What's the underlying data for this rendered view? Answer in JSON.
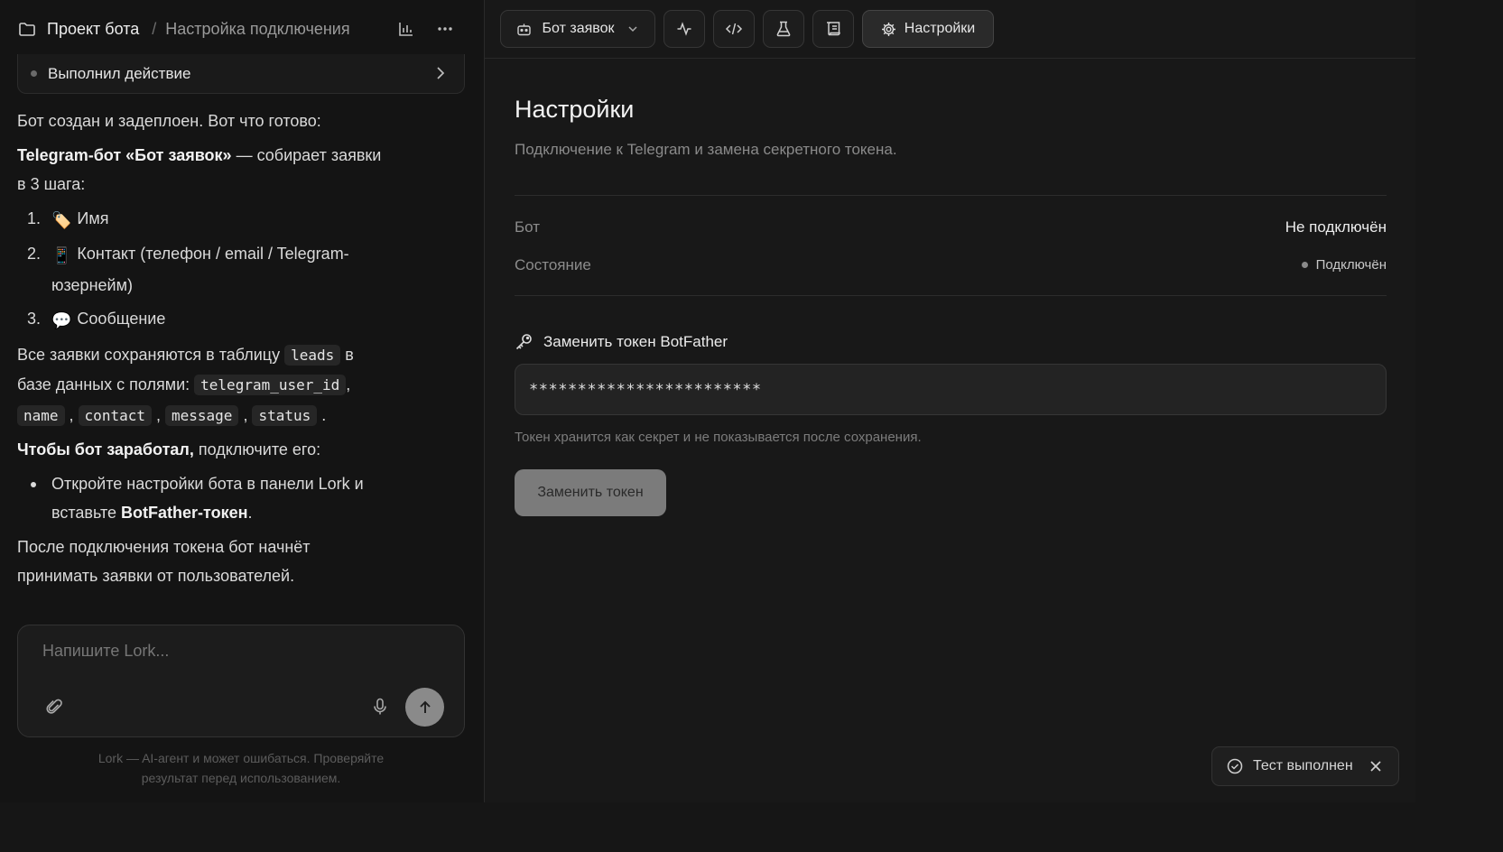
{
  "left": {
    "breadcrumb": {
      "project": "Проект бота",
      "separator": "/",
      "page": "Настройка подключения"
    },
    "action_card": {
      "label": "Выполнил действие"
    },
    "message": {
      "intro": "Бот создан и задеплоен. Вот что готово:",
      "bot_title": "Telegram-бот «Бот заявок»",
      "bot_desc_1": " — собирает заявки",
      "bot_desc_2": "в 3 шага:",
      "steps": [
        {
          "num": "1.",
          "emoji": "🏷️",
          "text": "Имя"
        },
        {
          "num": "2.",
          "emoji": "📱",
          "text_1": "Контакт (телефон / email / Telegram-",
          "text_2": "юзернейм)"
        },
        {
          "num": "3.",
          "emoji": "💬",
          "text": "Сообщение"
        }
      ],
      "storage_1": "Все заявки сохраняются в таблицу ",
      "table_name": "leads",
      "storage_2": " в",
      "storage_3": "базе данных с полями: ",
      "fields": [
        "telegram_user_id",
        "name",
        "contact",
        "message",
        "status"
      ],
      "connect_bold": "Чтобы бот заработал,",
      "connect_rest": " подключите его:",
      "bullet_1": "Откройте настройки бота в панели Lork и",
      "bullet_2": "вставьте ",
      "bullet_bold": "BotFather-токен",
      "bullet_end": ".",
      "outro_1": "После подключения токена бот начнёт",
      "outro_2": "принимать заявки от пользователей."
    },
    "composer": {
      "placeholder": "Напишите Lork..."
    },
    "disclaimer_1": "Lork — AI-агент и может ошибаться. Проверяйте",
    "disclaimer_2": "результат перед использованием."
  },
  "right": {
    "toolbar": {
      "bot_select": "Бот заявок",
      "settings": "Настройки"
    },
    "title": "Настройки",
    "subtitle": "Подключение к Telegram и замена секретного токена.",
    "rows": [
      {
        "key": "Бот",
        "value": "Не подключён"
      },
      {
        "key": "Состояние",
        "value": "Подключён"
      }
    ],
    "token_section": {
      "label": "Заменить токен BotFather",
      "value": "************************",
      "hint": "Токен хранится как секрет и не показывается после сохранения.",
      "button": "Заменить токен"
    }
  },
  "toast": {
    "text": "Тест выполнен"
  }
}
